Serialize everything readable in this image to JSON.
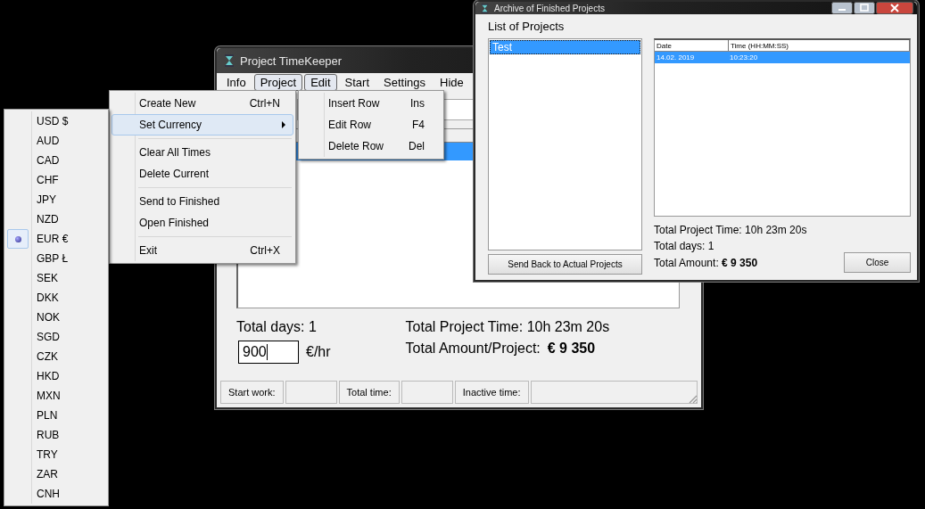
{
  "main_window": {
    "title": "Project TimeKeeper",
    "menubar": [
      {
        "label": "Info",
        "selected": false
      },
      {
        "label": "Project",
        "selected": true
      },
      {
        "label": "Edit",
        "selected": true
      },
      {
        "label": "Start",
        "selected": false
      },
      {
        "label": "Settings",
        "selected": false
      },
      {
        "label": "Hide",
        "selected": false
      }
    ],
    "total_days": "Total days: 1",
    "total_time": "Total Project Time: 10h 23m 20s",
    "rate": "900",
    "rate_unit": "€/hr",
    "amount_label": "Total Amount/Project:",
    "amount": "€ 9 350",
    "status_bar": [
      {
        "label": "Start work:"
      },
      {
        "label": "Total time:"
      },
      {
        "label": "Inactive time:"
      }
    ]
  },
  "project_menu": [
    {
      "kind": "item",
      "label": "Create New",
      "shortcut": "Ctrl+N",
      "highlighted": false,
      "submenu": false
    },
    {
      "kind": "item",
      "label": "Set Currency",
      "highlighted": true,
      "submenu": true
    },
    {
      "kind": "separator"
    },
    {
      "kind": "item",
      "label": "Clear All Times",
      "highlighted": false,
      "submenu": false
    },
    {
      "kind": "item",
      "label": "Delete Current",
      "highlighted": false,
      "submenu": false
    },
    {
      "kind": "separator"
    },
    {
      "kind": "item",
      "label": "Send to Finished",
      "highlighted": false,
      "submenu": false
    },
    {
      "kind": "item",
      "label": "Open Finished",
      "highlighted": false,
      "submenu": false
    },
    {
      "kind": "separator"
    },
    {
      "kind": "item",
      "label": "Exit",
      "shortcut": "Ctrl+X",
      "highlighted": false,
      "submenu": false
    }
  ],
  "edit_menu": [
    {
      "label": "Insert Row",
      "shortcut": "Ins"
    },
    {
      "label": "Edit Row",
      "shortcut": "F4"
    },
    {
      "label": "Delete Row",
      "shortcut": "Del"
    }
  ],
  "currency_menu": [
    {
      "label": "USD $",
      "selected": false
    },
    {
      "label": "AUD",
      "selected": false
    },
    {
      "label": "CAD",
      "selected": false
    },
    {
      "label": "CHF",
      "selected": false
    },
    {
      "label": "JPY",
      "selected": false
    },
    {
      "label": "NZD",
      "selected": false
    },
    {
      "label": "EUR €",
      "selected": true
    },
    {
      "label": "GBP Ł",
      "selected": false
    },
    {
      "label": "SEK",
      "selected": false
    },
    {
      "label": "DKK",
      "selected": false
    },
    {
      "label": "NOK",
      "selected": false
    },
    {
      "label": "SGD",
      "selected": false
    },
    {
      "label": "CZK",
      "selected": false
    },
    {
      "label": "HKD",
      "selected": false
    },
    {
      "label": "MXN",
      "selected": false
    },
    {
      "label": "PLN",
      "selected": false
    },
    {
      "label": "RUB",
      "selected": false
    },
    {
      "label": "TRY",
      "selected": false
    },
    {
      "label": "ZAR",
      "selected": false
    },
    {
      "label": "CNH",
      "selected": false
    }
  ],
  "archive_window": {
    "title": "Archive of Finished Projects",
    "list_title": "List of Projects",
    "projects": [
      {
        "name": "Test",
        "selected": true
      }
    ],
    "columns": [
      "Date",
      "Time (HH:MM:SS)"
    ],
    "rows": [
      {
        "date": "14.02. 2019",
        "time": "10:23:20",
        "selected": true
      }
    ],
    "total_time": "Total Project Time: 10h 23m 20s",
    "total_days": "Total days: 1",
    "amount_label": "Total Amount:",
    "amount": "€ 9 350",
    "buttons": [
      "Send Back to Actual Projects",
      "Close"
    ]
  }
}
